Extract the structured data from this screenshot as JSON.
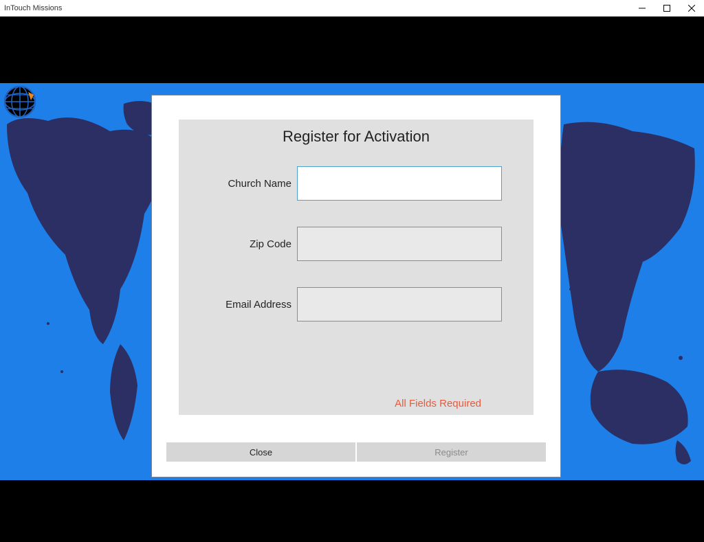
{
  "window": {
    "title": "InTouch Missions"
  },
  "dialog": {
    "title": "Register for Activation",
    "fields": {
      "church_name": {
        "label": "Church Name",
        "value": ""
      },
      "zip_code": {
        "label": "Zip Code",
        "value": ""
      },
      "email": {
        "label": "Email Address",
        "value": ""
      }
    },
    "required_note": "All Fields Required",
    "buttons": {
      "close": "Close",
      "register": "Register"
    }
  }
}
